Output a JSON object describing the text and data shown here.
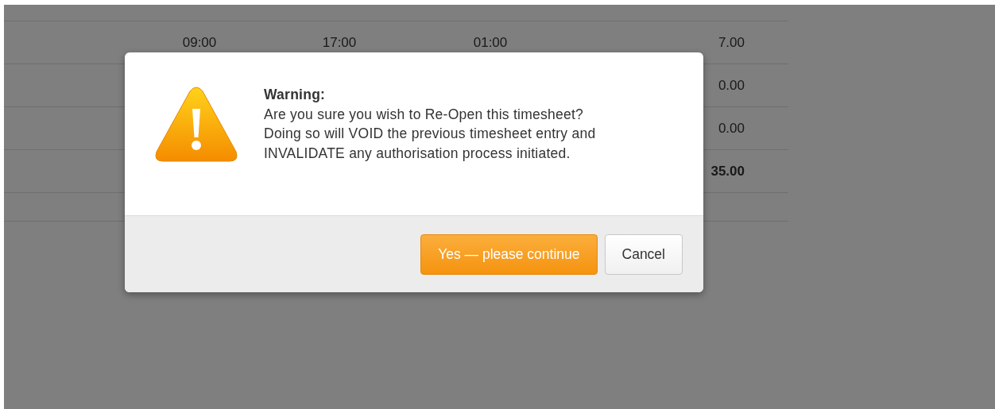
{
  "table": {
    "rows": [
      {
        "kind": "entry",
        "column_1": "09:00",
        "column_2": "17:00",
        "column_3": "01:00",
        "column_4": "7.00"
      },
      {
        "kind": "entry",
        "column_4": "0.00"
      },
      {
        "kind": "entry",
        "column_4": "0.00"
      },
      {
        "kind": "total",
        "column_4": "35.00"
      },
      {
        "kind": "blank"
      }
    ]
  },
  "dialog": {
    "title": "Warning:",
    "lines": [
      "Are you sure you wish to Re-Open this timesheet?",
      "Doing so will VOID the previous timesheet entry and",
      "INVALIDATE any authorisation process initiated."
    ],
    "buttons": [
      {
        "label": "Yes — please continue",
        "kind": "primary"
      },
      {
        "label": "Cancel",
        "kind": "secondary"
      }
    ]
  }
}
